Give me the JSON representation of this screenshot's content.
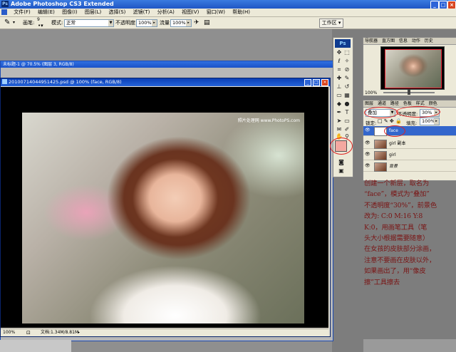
{
  "app": {
    "title": "Adobe Photoshop CS3 Extended",
    "icon": "ps-app-icon"
  },
  "menu": [
    "文件(F)",
    "编辑(E)",
    "图像(I)",
    "图层(L)",
    "选择(S)",
    "滤镜(T)",
    "分析(A)",
    "视图(V)",
    "窗口(W)",
    "帮助(H)"
  ],
  "options": {
    "brush_label": "画笔:",
    "brush_size": "9",
    "mode_label": "模式:",
    "mode_value": "正常",
    "opacity_label": "不透明度:",
    "opacity_value": "100%",
    "flow_label": "流量:",
    "flow_value": "100%",
    "workspace": "工作区"
  },
  "back_doc": {
    "title": "未标题-1 @ 70.5% (图层 3, RGB/8)"
  },
  "front_doc": {
    "title": "20100714044951425.psd @ 100% (face, RGB/8)",
    "watermark": "照片处理网 www.PhotoPS.com",
    "zoom": "100%",
    "doc_size": "文档:1.34M/8.81M"
  },
  "tools": {
    "logo": "Ps",
    "foreground_color": "#f3a8a0",
    "background_color": "#ffffff"
  },
  "navigator": {
    "tabs": [
      "导航器",
      "直方图",
      "信息",
      "动作",
      "历史"
    ],
    "zoom": "100%"
  },
  "layers": {
    "tabs": [
      "图层",
      "通道",
      "路径",
      "色板",
      "样式",
      "颜色"
    ],
    "blend_mode": "叠加",
    "opacity_label": "不透明度:",
    "opacity_value": "30%",
    "lock_label": "锁定:",
    "fill_label": "填充:",
    "fill_value": "100%",
    "items": [
      {
        "name": "face",
        "selected": true
      },
      {
        "name": "girl 副本",
        "selected": false
      },
      {
        "name": "girl",
        "selected": false
      },
      {
        "name": "背景",
        "selected": false
      }
    ]
  },
  "instruction": "创建一个新层，取名为\n“face”，模式为“叠加”\n不透明度“30%”，前景色\n改为: C:0 M:16 Y:8\nK:0，用画笔工具（笔\n头大小根据需要随意）\n在女孩的皮肤部分涂画，\n注意不要画在皮肤以外，\n如果画出了，用“像皮\n擦”工具擦去",
  "colors": {
    "accent": "#1f56c4",
    "annotation": "#e02020",
    "instruction_text": "#7a1414"
  }
}
